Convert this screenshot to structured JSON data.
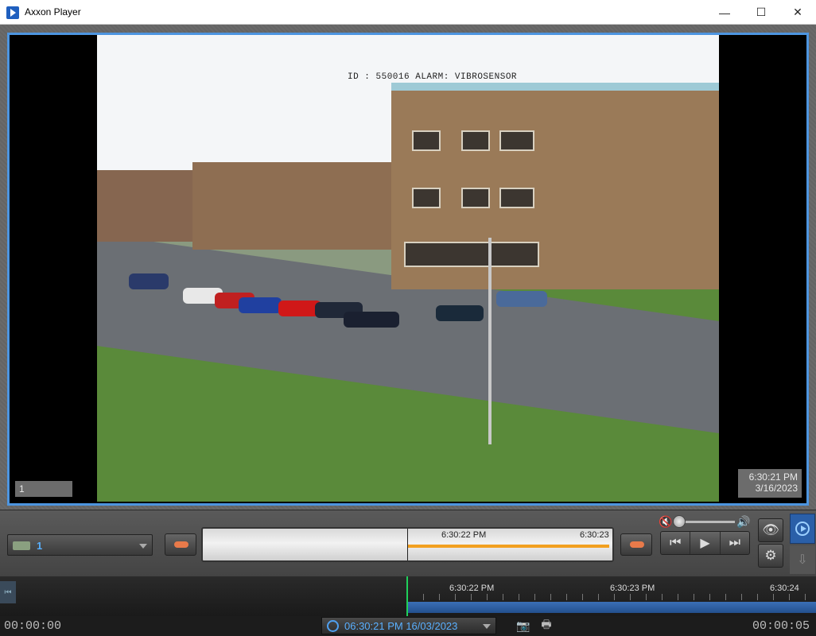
{
  "window": {
    "title": "Axxon Player",
    "minimize_glyph": "—",
    "maximize_glyph": "☐",
    "close_glyph": "✕"
  },
  "video": {
    "osd_text": "ID : 550016   ALARM: VIBROSENSOR",
    "camera_label": "1",
    "timestamp_time": "6:30:21 PM",
    "timestamp_date": "3/16/2023"
  },
  "controls": {
    "camera_select_value": "1",
    "mini_timeline_labels": [
      "6:30:22 PM",
      "6:30:23"
    ],
    "transport": {
      "prev_frame_glyph": "⏮",
      "play_glyph": "▶",
      "next_frame_glyph": "⏭"
    },
    "eye_glyph": "👁",
    "settings_glyph": "⚙",
    "export_glyph": "⇩"
  },
  "timeline": {
    "labels": [
      "6:30:22 PM",
      "6:30:23 PM",
      "6:30:24"
    ]
  },
  "status": {
    "elapsed": "00:00:00",
    "duration": "00:00:05",
    "current_datetime": "06:30:21 PM 16/03/2023",
    "snapshot_glyph": "📷",
    "print_glyph": "🖶"
  },
  "colors": {
    "accent": "#4d95e0",
    "cursor_green": "#1fd05a",
    "orange_bar": "#f2a020",
    "datetime_blue": "#5ab0ff"
  }
}
